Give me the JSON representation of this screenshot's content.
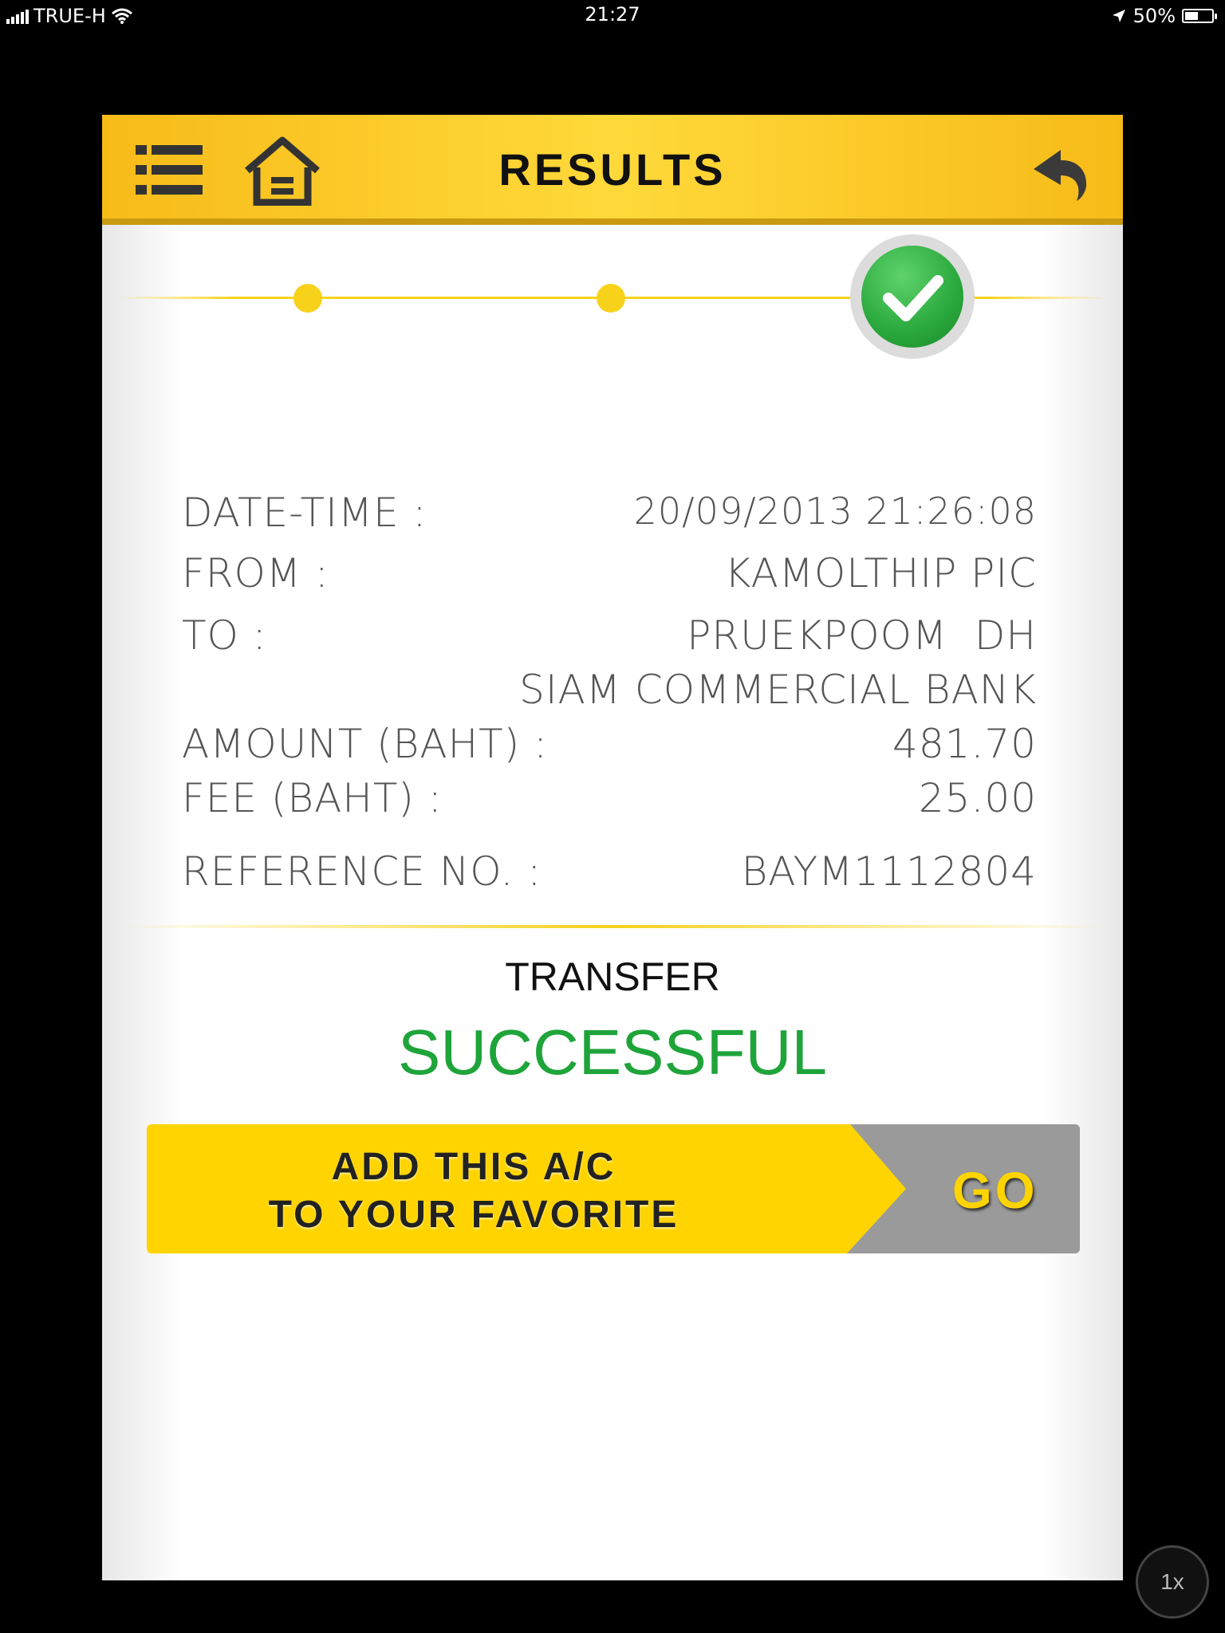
{
  "status_bar": {
    "carrier": "TRUE-H",
    "time": "21:27",
    "battery_percent": "50%",
    "battery_level": 0.5
  },
  "header": {
    "title": "RESULTS",
    "menu_icon": "menu-list-icon",
    "home_icon": "home-icon",
    "back_icon": "back-arrow-icon"
  },
  "progress": {
    "current_step": 3,
    "total_steps": 3
  },
  "details": {
    "datetime_label": "DATE-TIME :",
    "datetime_value": "20/09/2013 21:26:08",
    "from_label": "FROM :",
    "from_value": "KAMOLTHIP PIC",
    "to_label": "TO :",
    "to_name": "PRUEKPOOM  DH",
    "to_bank": "SIAM COMMERCIAL BANK",
    "amount_label": "AMOUNT (BAHT) :",
    "amount_value": "481.70",
    "fee_label": "FEE (BAHT) :",
    "fee_value": "25.00",
    "reference_label": "REFERENCE NO. :",
    "reference_value": "BAYM1112804"
  },
  "result": {
    "transfer_label": "TRANSFER",
    "status": "SUCCESSFUL",
    "status_color": "#1fa43a"
  },
  "favorite_button": {
    "line1": "ADD THIS A/C",
    "line2": "TO YOUR FAVORITE",
    "go_label": "GO"
  },
  "zoom_badge": "1x",
  "colors": {
    "header_yellow": "#ffd93a",
    "accent_yellow": "#ffd400",
    "success_green": "#1fa43a"
  }
}
